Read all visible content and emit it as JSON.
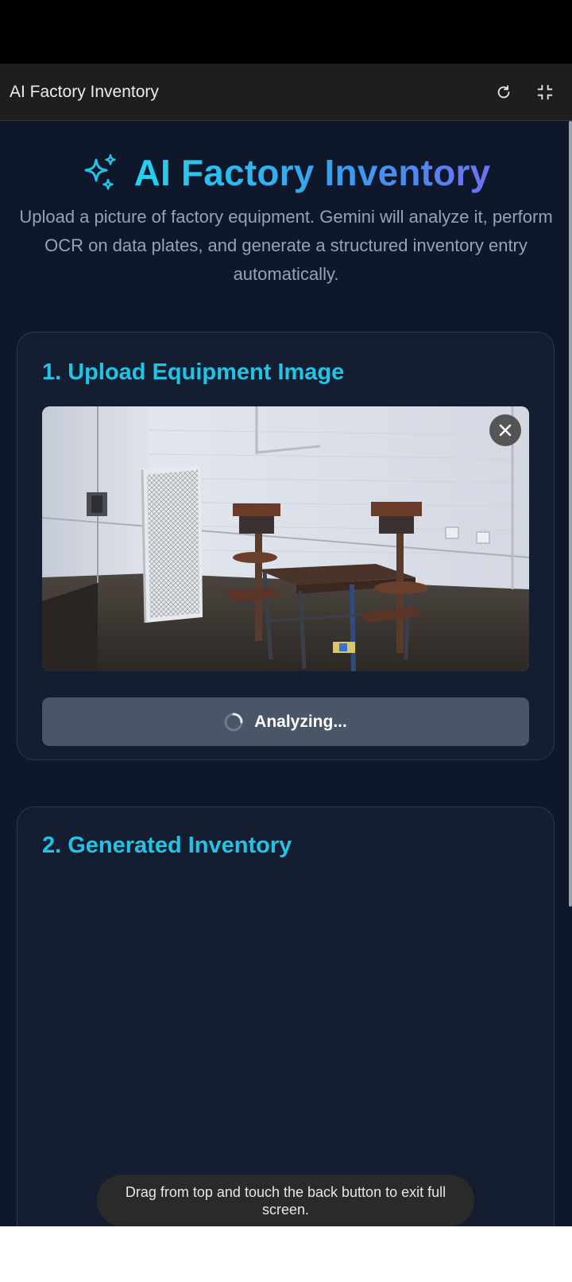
{
  "appbar": {
    "title": "AI Factory Inventory",
    "reload_icon": "reload-icon",
    "exit_fullscreen_icon": "exit-fullscreen-icon"
  },
  "hero": {
    "title": "AI Factory Inventory",
    "icon": "sparkles-icon",
    "subtitle": "Upload a picture of factory equipment. Gemini will analyze it, perform OCR on data plates, and generate a structured inventory entry automatically."
  },
  "upload_card": {
    "heading": "1. Upload Equipment Image",
    "close_icon": "close-icon",
    "analyze_label": "Analyzing...",
    "spinner_icon": "spinner-icon"
  },
  "inventory_card": {
    "heading": "2. Generated Inventory"
  },
  "toast": {
    "message": "Drag from top and touch the back button to exit full screen."
  },
  "colors": {
    "background": "#0f172a",
    "card": "#141e30",
    "accent": "#22c4e6",
    "button": "#4a5568"
  }
}
